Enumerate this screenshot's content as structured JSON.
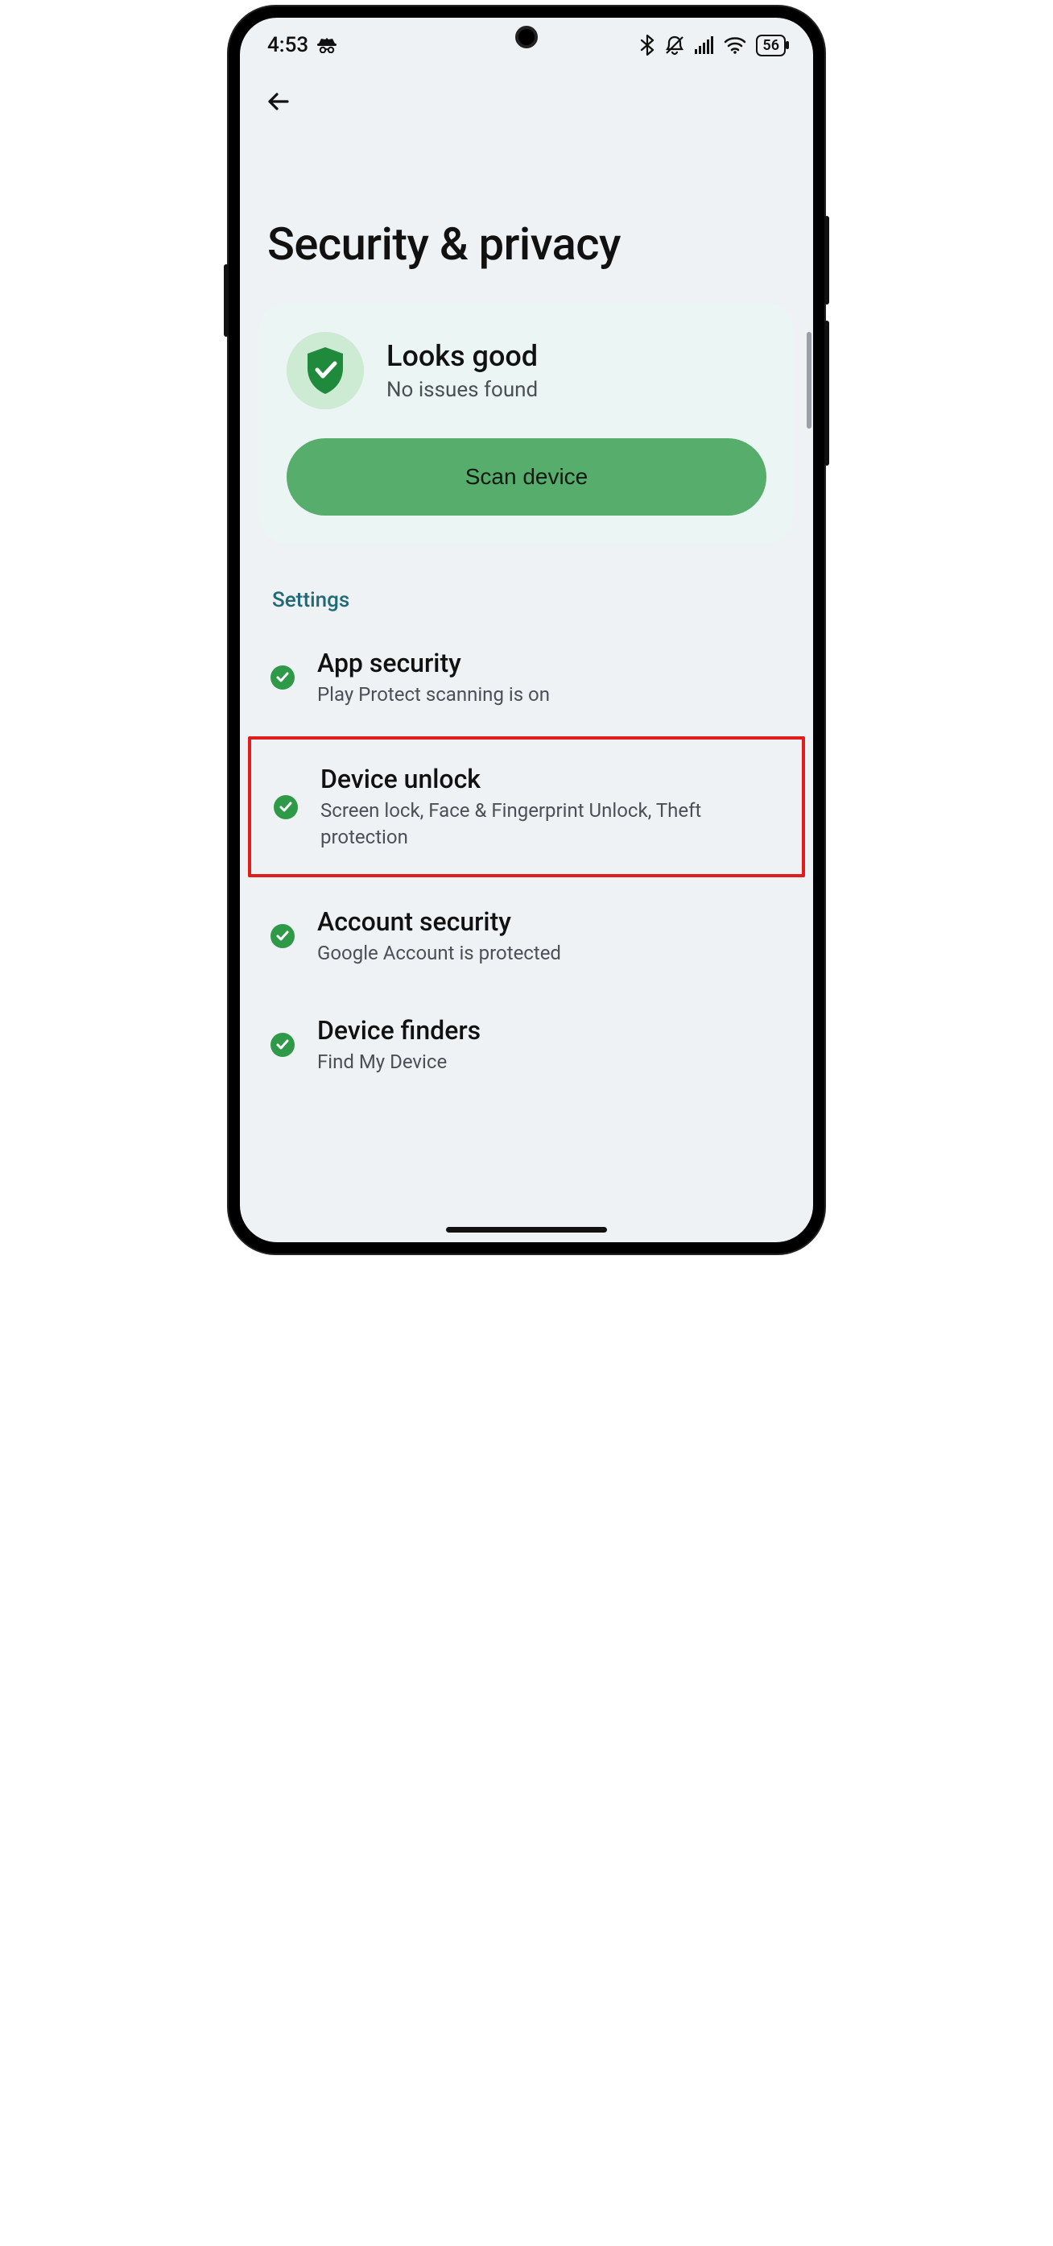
{
  "status_bar": {
    "time": "4:53",
    "battery": "56"
  },
  "page": {
    "title": "Security & privacy"
  },
  "status_card": {
    "heading": "Looks good",
    "sub": "No issues found",
    "button": "Scan device"
  },
  "section_label": "Settings",
  "settings": [
    {
      "title": "App security",
      "desc": "Play Protect scanning is on"
    },
    {
      "title": "Device unlock",
      "desc": "Screen lock, Face & Fingerprint Unlock, Theft protection"
    },
    {
      "title": "Account security",
      "desc": "Google Account is protected"
    },
    {
      "title": "Device finders",
      "desc": "Find My Device"
    }
  ],
  "highlight_index": 1
}
